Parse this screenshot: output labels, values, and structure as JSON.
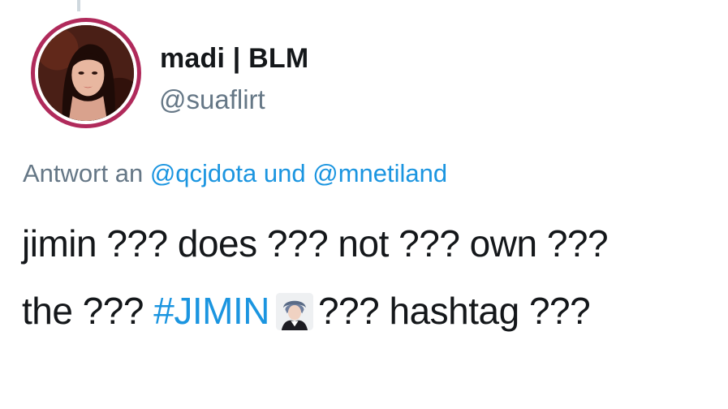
{
  "user": {
    "display_name": "madi | BLM",
    "handle": "@suaflirt"
  },
  "reply": {
    "prefix": "Antwort an",
    "mention_1": "@qcjdota",
    "conjunction": "und",
    "mention_2": "@mnetiland"
  },
  "tweet": {
    "line1": "jimin ??? does ??? not ??? own ???",
    "line2_before": "the ???",
    "hashtag": "#JIMIN",
    "hashtag_emoji": "jimin-hashflag-icon",
    "line2_after": "??? hashtag ???"
  },
  "colors": {
    "link": "#1b95e0",
    "secondary_text": "#657786",
    "primary_text": "#14171a",
    "avatar_ring": "#b02a5b"
  }
}
